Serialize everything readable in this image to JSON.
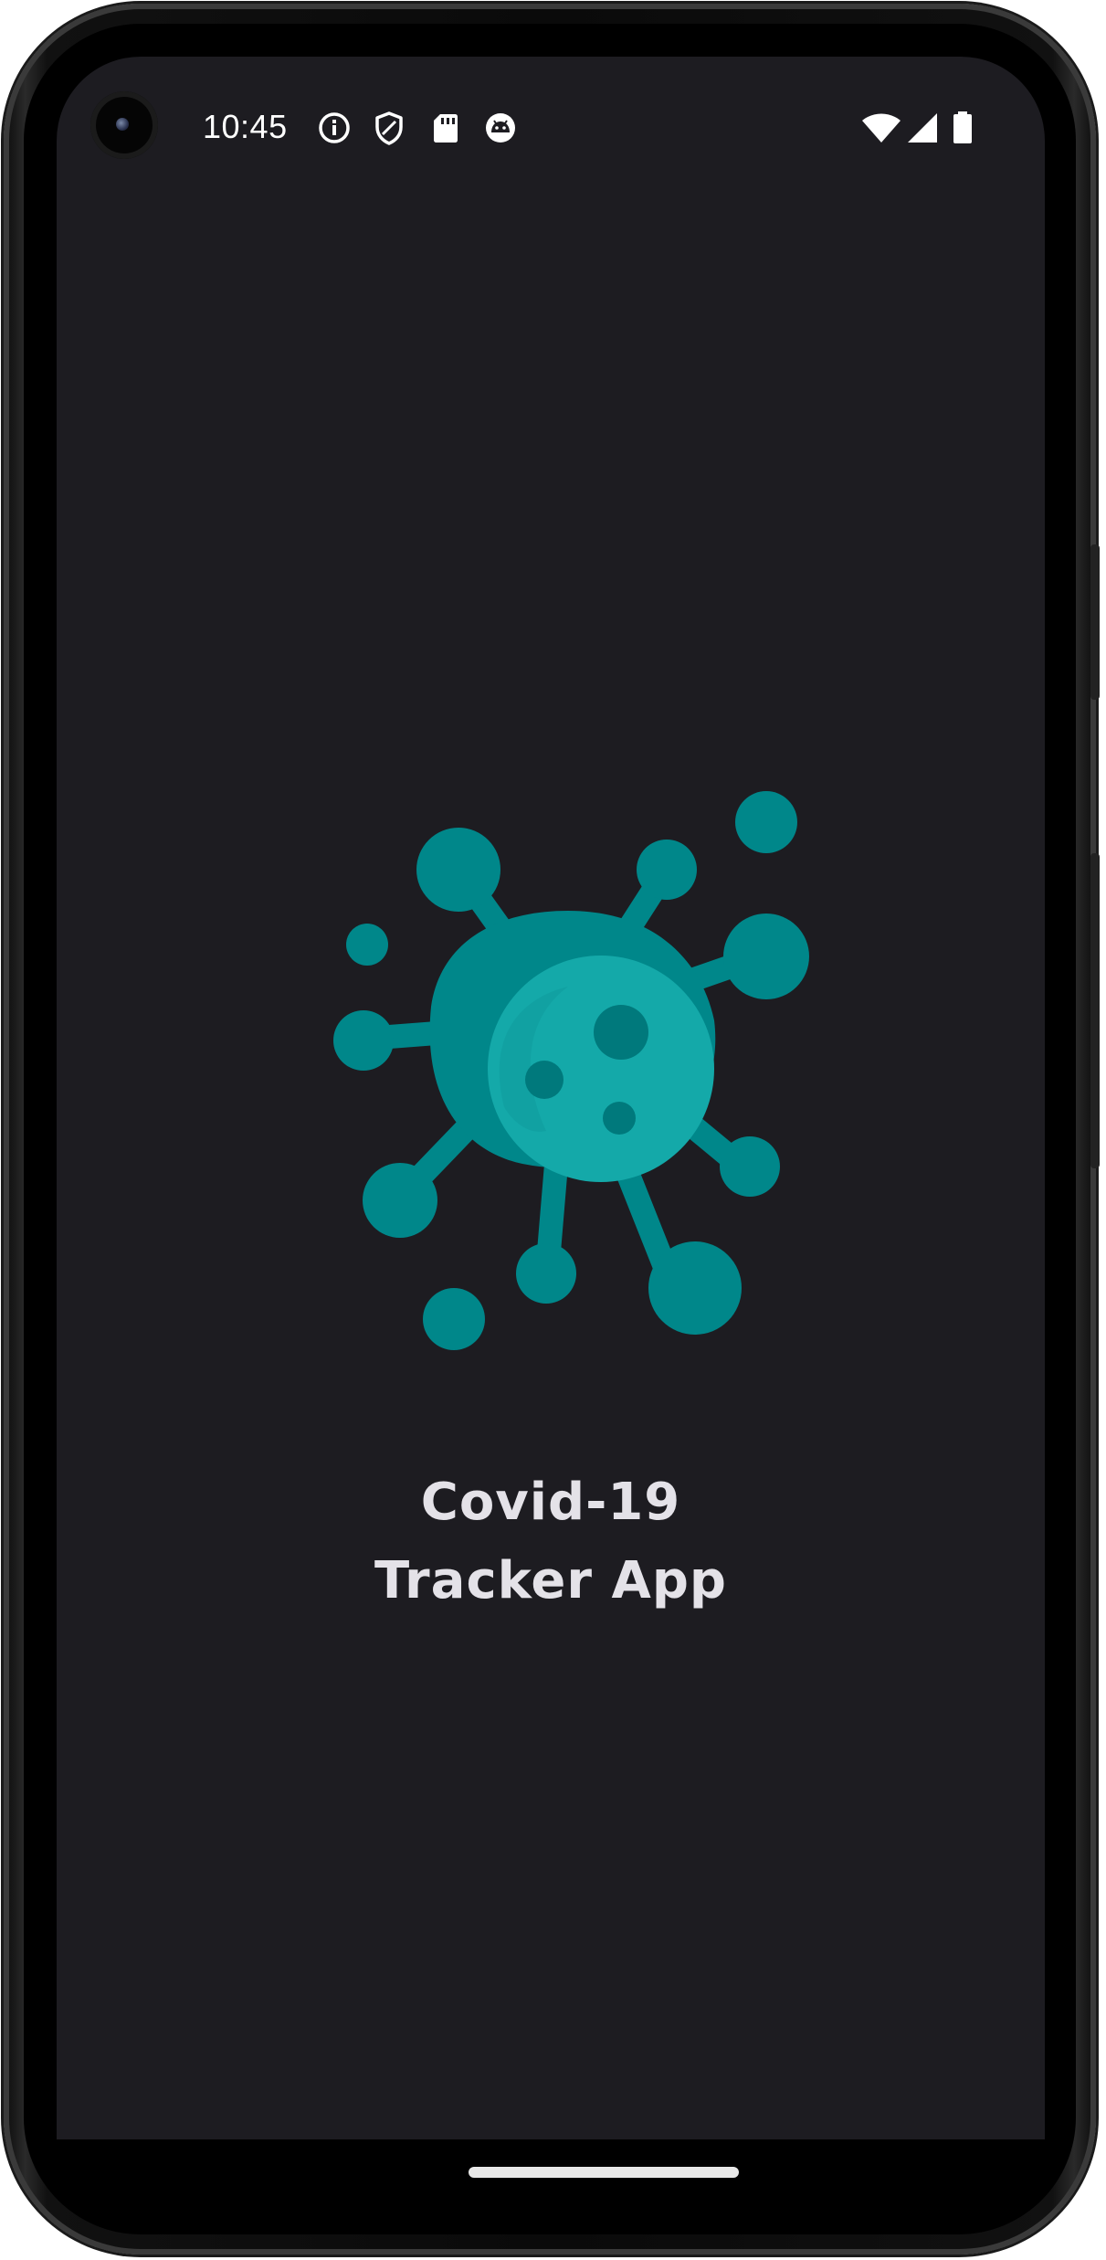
{
  "status_bar": {
    "time": "10:45",
    "left_icons": [
      "info-icon",
      "shield-icon",
      "sd-card-icon",
      "android-debug-icon"
    ],
    "right_icons": [
      "wifi-icon",
      "cellular-signal-icon",
      "battery-icon"
    ]
  },
  "splash": {
    "logo_icon": "virus-icon",
    "title_line1": "Covid-19",
    "title_line2": "Tracker App"
  },
  "colors": {
    "background": "#1d1c21",
    "virus_dark": "#00878a",
    "virus_light": "#14a9a9",
    "title_text": "#e4e2e8"
  }
}
